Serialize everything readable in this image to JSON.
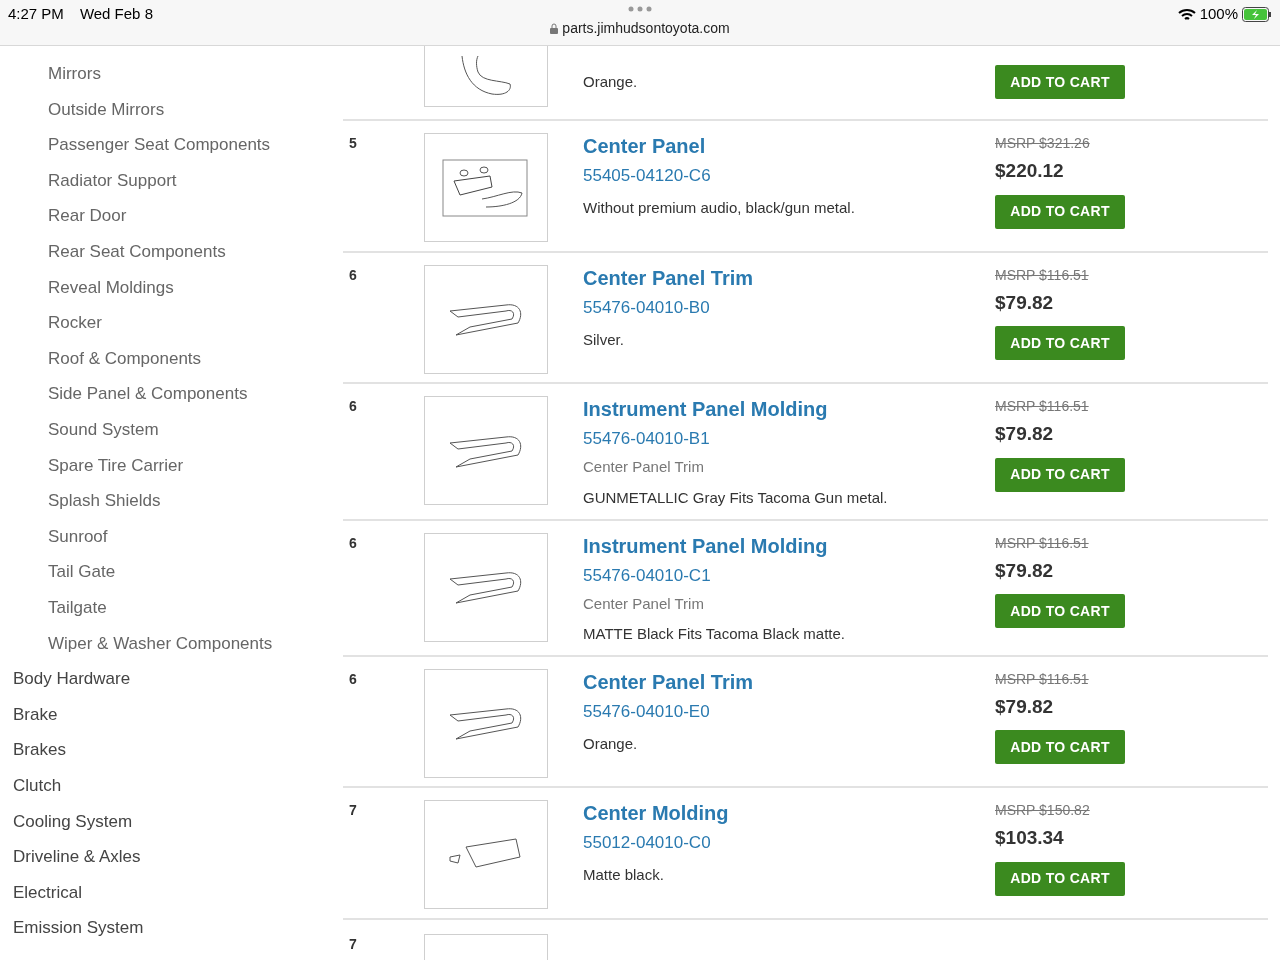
{
  "status_bar": {
    "time": "4:27 PM",
    "date": "Wed Feb 8",
    "url": "parts.jimhudsontoyota.com",
    "battery": "100%"
  },
  "sidebar": {
    "items": [
      {
        "label": "Mirrors",
        "kind": "sub"
      },
      {
        "label": "Outside Mirrors",
        "kind": "sub"
      },
      {
        "label": "Passenger Seat Components",
        "kind": "sub"
      },
      {
        "label": "Radiator Support",
        "kind": "sub"
      },
      {
        "label": "Rear Door",
        "kind": "sub"
      },
      {
        "label": "Rear Seat Components",
        "kind": "sub"
      },
      {
        "label": "Reveal Moldings",
        "kind": "sub"
      },
      {
        "label": "Rocker",
        "kind": "sub"
      },
      {
        "label": "Roof & Components",
        "kind": "sub"
      },
      {
        "label": "Side Panel & Components",
        "kind": "sub"
      },
      {
        "label": "Sound System",
        "kind": "sub"
      },
      {
        "label": "Spare Tire Carrier",
        "kind": "sub"
      },
      {
        "label": "Splash Shields",
        "kind": "sub"
      },
      {
        "label": "Sunroof",
        "kind": "sub"
      },
      {
        "label": "Tail Gate",
        "kind": "sub"
      },
      {
        "label": "Tailgate",
        "kind": "sub"
      },
      {
        "label": "Wiper & Washer Components",
        "kind": "sub"
      },
      {
        "label": "Body Hardware",
        "kind": "top"
      },
      {
        "label": "Brake",
        "kind": "top"
      },
      {
        "label": "Brakes",
        "kind": "top"
      },
      {
        "label": "Clutch",
        "kind": "top"
      },
      {
        "label": "Cooling System",
        "kind": "top"
      },
      {
        "label": "Driveline & Axles",
        "kind": "top"
      },
      {
        "label": "Electrical",
        "kind": "top"
      },
      {
        "label": "Emission System",
        "kind": "top"
      }
    ]
  },
  "parts": [
    {
      "kind": "partial",
      "description": "Orange.",
      "button": "ADD TO CART"
    },
    {
      "kind": "full",
      "qty": "5",
      "title": "Center Panel",
      "part_number": "55405-04120-C6",
      "description": "Without premium audio, black/gun metal.",
      "msrp": "MSRP $321.26",
      "price": "$220.12",
      "button": "ADD TO CART"
    },
    {
      "kind": "full",
      "qty": "6",
      "title": "Center Panel Trim",
      "part_number": "55476-04010-B0",
      "description": "Silver.",
      "msrp": "MSRP $116.51",
      "price": "$79.82",
      "button": "ADD TO CART"
    },
    {
      "kind": "full",
      "qty": "6",
      "title": "Instrument Panel Molding",
      "part_number": "55476-04010-B1",
      "subtitle": "Center Panel Trim",
      "description": "GUNMETALLIC Gray Fits Tacoma Gun metal.",
      "msrp": "MSRP $116.51",
      "price": "$79.82",
      "button": "ADD TO CART"
    },
    {
      "kind": "full",
      "qty": "6",
      "title": "Instrument Panel Molding",
      "part_number": "55476-04010-C1",
      "subtitle": "Center Panel Trim",
      "description": "MATTE Black Fits Tacoma Black matte.",
      "msrp": "MSRP $116.51",
      "price": "$79.82",
      "button": "ADD TO CART"
    },
    {
      "kind": "full",
      "qty": "6",
      "title": "Center Panel Trim",
      "part_number": "55476-04010-E0",
      "description": "Orange.",
      "msrp": "MSRP $116.51",
      "price": "$79.82",
      "button": "ADD TO CART"
    },
    {
      "kind": "full",
      "qty": "7",
      "title": "Center Molding",
      "part_number": "55012-04010-C0",
      "description": "Matte black.",
      "msrp": "MSRP $150.82",
      "price": "$103.34",
      "button": "ADD TO CART"
    },
    {
      "kind": "cut",
      "qty": "7"
    }
  ]
}
